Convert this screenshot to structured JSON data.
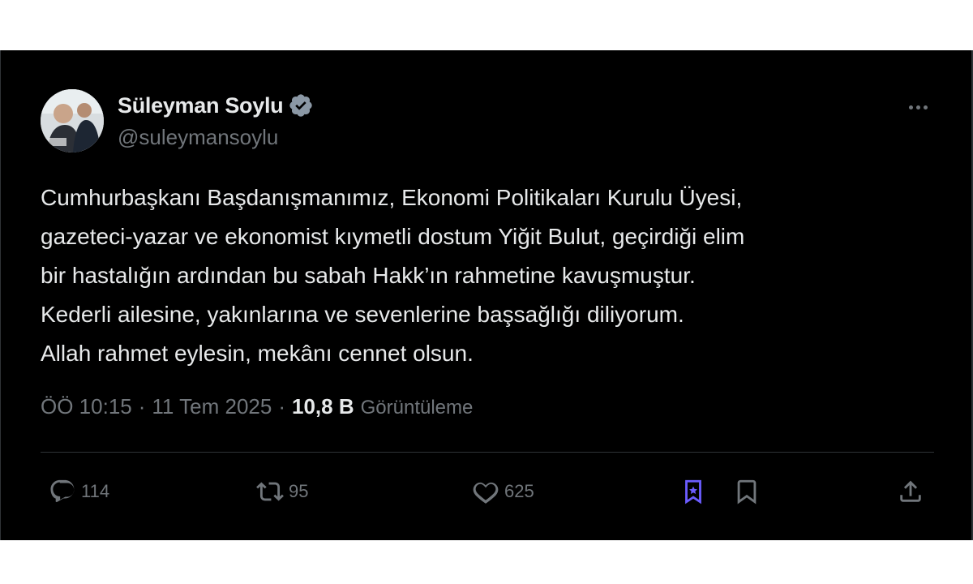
{
  "author": {
    "name": "Süleyman Soylu",
    "handle": "@suleymansoylu",
    "verified": true,
    "verified_color": "#8b98a5"
  },
  "tweet": {
    "text": "Cumhurbaşkanı Başdanışmanımız, Ekonomi Politikaları Kurulu Üyesi,\ngazeteci-yazar ve ekonomist kıymetli dostum Yiğit Bulut, geçirdiği elim\nbir hastalığın ardından bu sabah Hakk’ın rahmetine kavuşmuştur.\nKederli ailesine, yakınlarına ve sevenlerine başsağlığı diliyorum.\nAllah rahmet eylesin, mekânı cennet olsun.",
    "time": "ÖÖ 10:15",
    "separator": "·",
    "date": "11 Tem 2025",
    "views_count": "10,8 B",
    "views_label": "Görüntüleme"
  },
  "actions": {
    "reply_count": "114",
    "repost_count": "95",
    "like_count": "625"
  },
  "icons": {
    "more": "more-horizontal-icon",
    "reply": "reply-bubble-icon",
    "repost": "repost-icon",
    "like": "heart-icon",
    "grok": "grok-icon",
    "bookmark": "bookmark-icon",
    "share": "share-icon"
  },
  "colors": {
    "background": "#000000",
    "text": "#e7e9ea",
    "muted": "#71767b",
    "accent_purple": "#6b5cff"
  }
}
